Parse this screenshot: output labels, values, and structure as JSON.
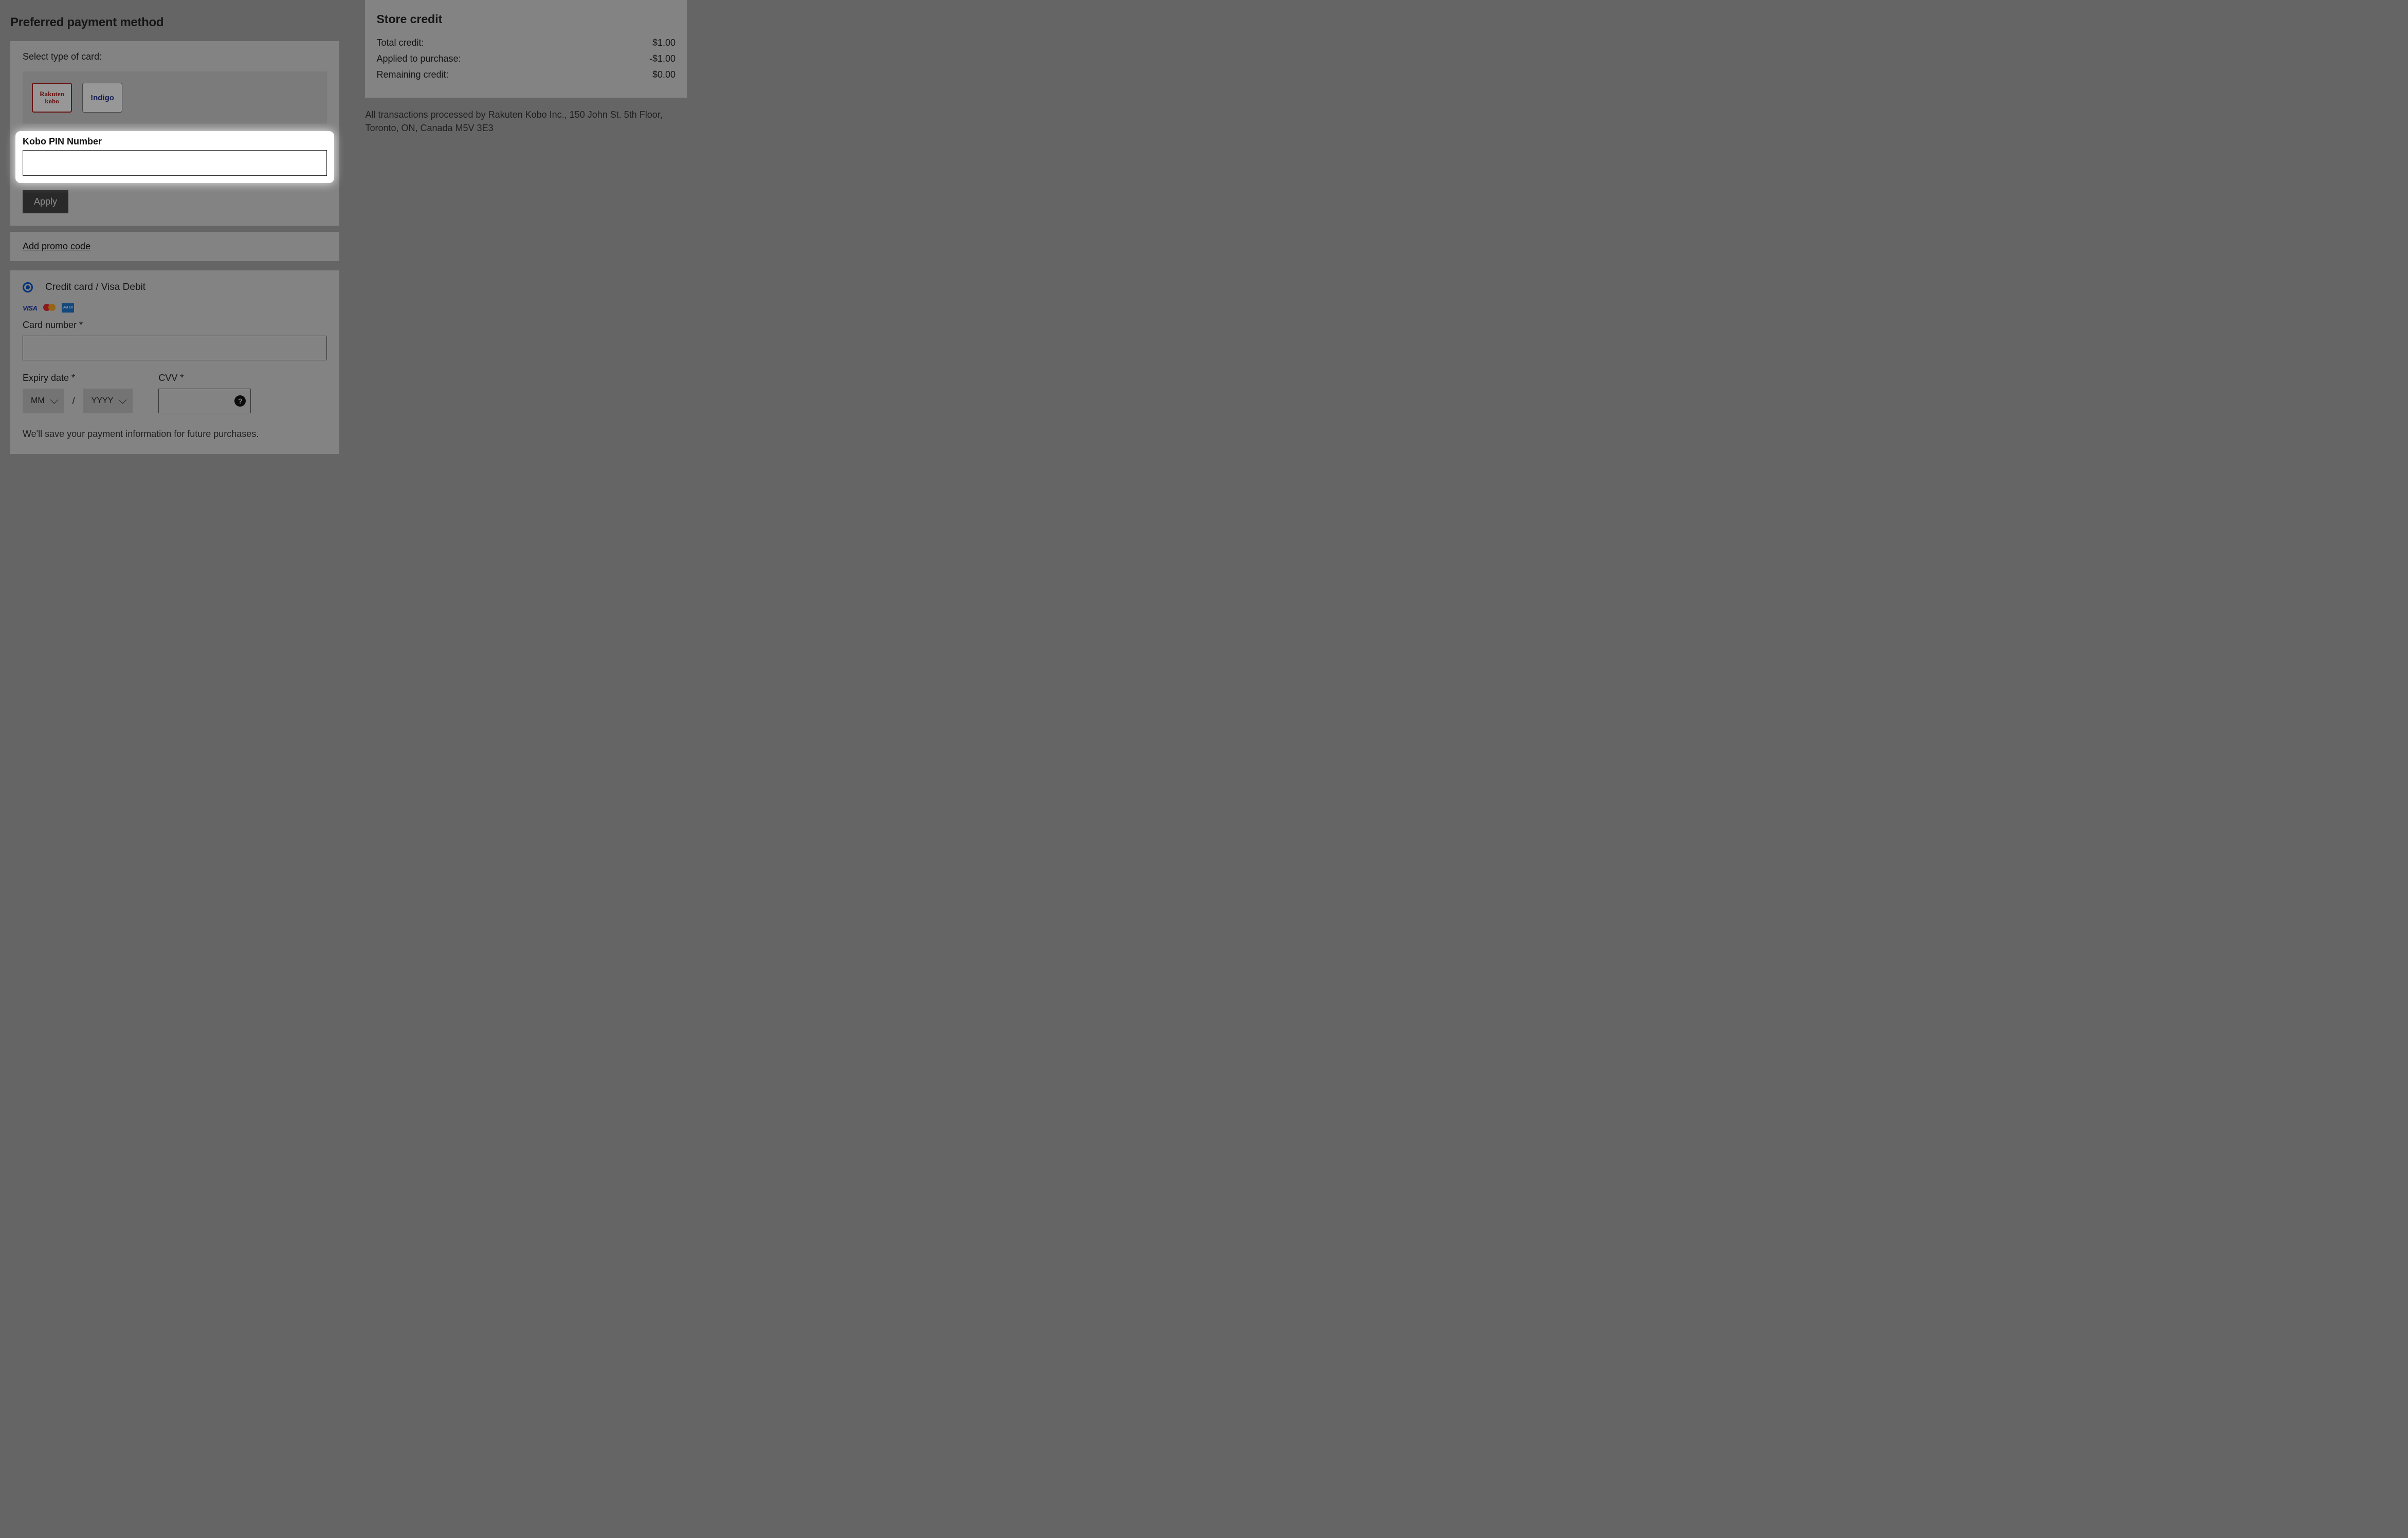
{
  "left": {
    "heading": "Preferred payment method",
    "select_card_label": "Select type of card:",
    "card_options": {
      "kobo": "Rakuten\nkobo",
      "indigo": "!ndigo"
    },
    "pin_label": "Kobo PIN Number",
    "pin_value": "",
    "apply_label": "Apply",
    "promo_link": "Add promo code",
    "cc": {
      "radio_label": "Credit card / Visa Debit",
      "logos": {
        "visa": "VISA",
        "amex": "AM EX"
      },
      "card_number_label": "Card number *",
      "card_number_value": "",
      "expiry_label": "Expiry date *",
      "mm_placeholder": "MM",
      "slash": "/",
      "yyyy_placeholder": "YYYY",
      "cvv_label": "CVV *",
      "cvv_value": "",
      "cvv_help": "?",
      "save_note": "We'll save your payment information for future purchases."
    }
  },
  "right": {
    "heading": "Store credit",
    "rows": [
      {
        "label": "Total credit:",
        "value": "$1.00"
      },
      {
        "label": "Applied to purchase:",
        "value": "-$1.00"
      },
      {
        "label": "Remaining credit:",
        "value": "$0.00"
      }
    ],
    "disclaimer": "All transactions processed by Rakuten Kobo Inc., 150 John St. 5th Floor, Toronto, ON, Canada M5V 3E3"
  }
}
